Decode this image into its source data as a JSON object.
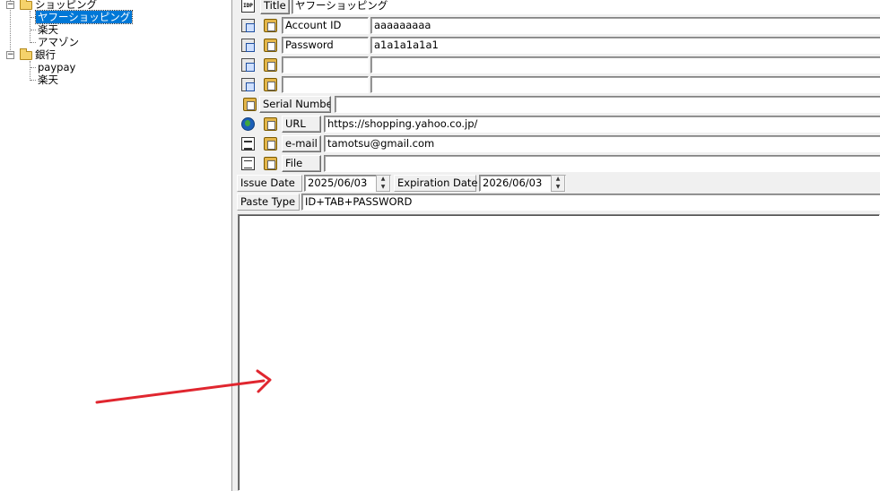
{
  "tree": {
    "nodes": [
      {
        "label": "ショッピング"
      },
      {
        "label": "ヤフーショッピング"
      },
      {
        "label": "楽天"
      },
      {
        "label": "アマゾン"
      },
      {
        "label": "銀行"
      },
      {
        "label": "paypay"
      },
      {
        "label": "楽天"
      }
    ],
    "expander_glyph": "−"
  },
  "form": {
    "title": {
      "label": "Title",
      "value": "ヤフーショッピング"
    },
    "fields": [
      {
        "label": "Account ID",
        "value": "aaaaaaaaa"
      },
      {
        "label": "Password",
        "value": "a1a1a1a1a1"
      },
      {
        "label": "",
        "value": ""
      },
      {
        "label": "",
        "value": ""
      }
    ],
    "serial": {
      "label": "Serial Number",
      "value": ""
    },
    "url": {
      "label": "URL",
      "value": "https://shopping.yahoo.co.jp/"
    },
    "email": {
      "label": "e-mail",
      "value": "tamotsu@gmail.com"
    },
    "file": {
      "label": "File",
      "value": ""
    },
    "issue_date": {
      "label": "Issue Date",
      "value": "2025/06/03"
    },
    "expiration_date": {
      "label": "Expiration Date",
      "value": "2026/06/03"
    },
    "paste_type": {
      "label": "Paste Type",
      "value": "ID+TAB+PASSWORD"
    },
    "memo": {
      "value": ""
    }
  },
  "icons": {
    "idp": "IDP",
    "spin_up": "▲",
    "spin_down": "▼"
  },
  "colors": {
    "selection": "#0078d7",
    "annotation_arrow": "#e0262f"
  }
}
